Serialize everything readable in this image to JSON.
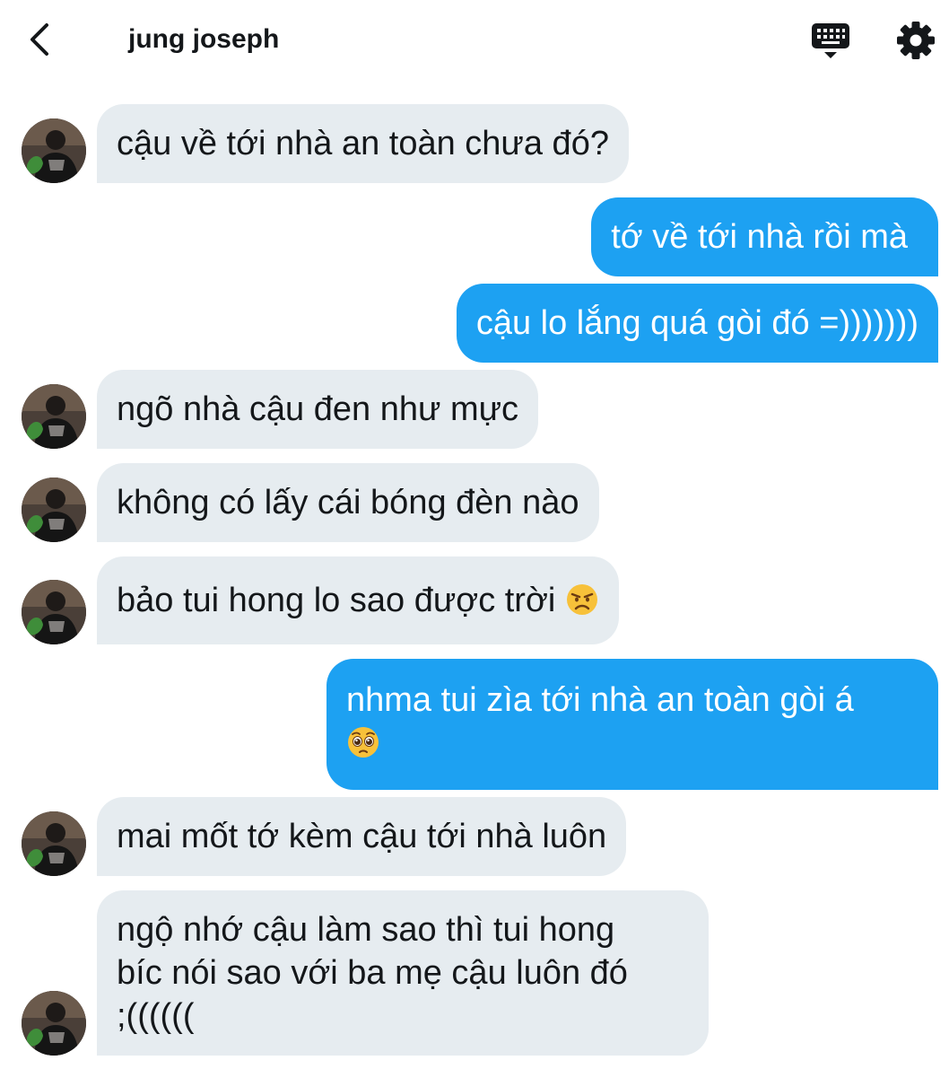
{
  "header": {
    "title": "jung joseph",
    "back_icon": "chevron-left-icon",
    "keyboard_icon": "keyboard-icon",
    "settings_icon": "gear-icon"
  },
  "colors": {
    "outgoing_bubble": "#1da1f2",
    "incoming_bubble": "#e6ecf0",
    "text": "#14171a"
  },
  "messages": [
    {
      "from": "them",
      "text": "cậu về tới nhà an toàn chưa đó?"
    },
    {
      "from": "me",
      "text": "tớ về tới nhà rồi mà"
    },
    {
      "from": "me",
      "text": "cậu lo lắng quá gòi đó =)))))))"
    },
    {
      "from": "them",
      "text": "ngõ nhà cậu đen như mực"
    },
    {
      "from": "them",
      "text": "không có lấy cái bóng đèn nào"
    },
    {
      "from": "them",
      "text": "bảo tui hong lo sao được trời",
      "emoji": "angry-face-emoji"
    },
    {
      "from": "me",
      "text": "nhma tui zìa tới nhà an toàn gòi á",
      "emoji": "pleading-face-emoji"
    },
    {
      "from": "them",
      "text": "mai mốt tớ kèm cậu tới nhà luôn"
    },
    {
      "from": "them",
      "lines": [
        "ngộ nhớ cậu làm sao thì tui hong",
        "bíc nói sao với ba mẹ cậu luôn đó",
        ";(((((("
      ]
    }
  ]
}
